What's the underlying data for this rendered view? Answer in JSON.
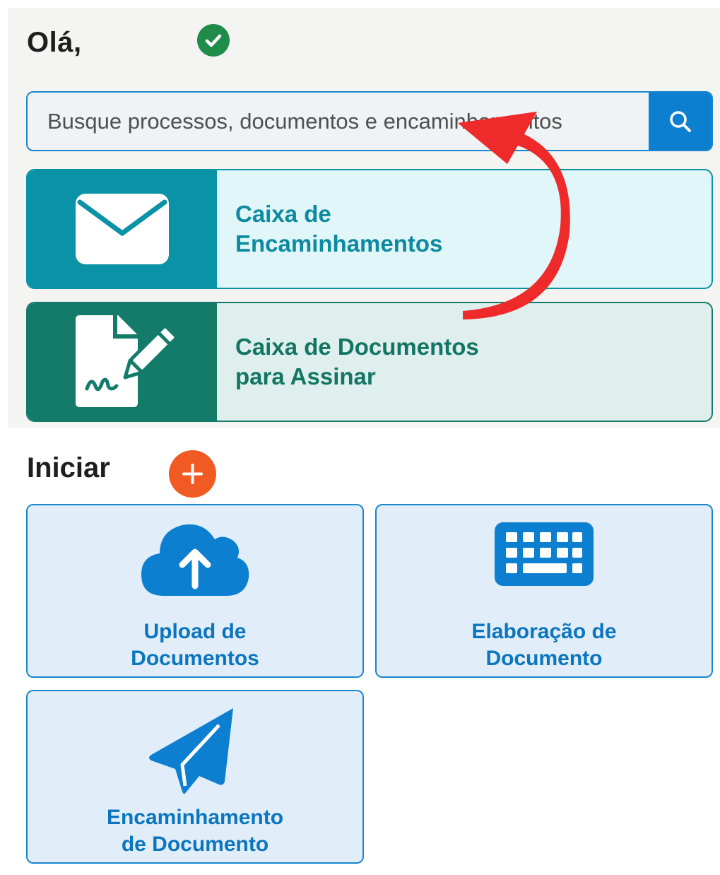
{
  "header": {
    "greeting": "Olá,"
  },
  "search": {
    "placeholder": "Busque processos, documentos e encaminhamentos"
  },
  "cards": [
    {
      "label": "Caixa de\nEncaminhamentos",
      "icon": "envelope-icon"
    },
    {
      "label": "Caixa de Documentos\npara Assinar",
      "icon": "document-signature-icon"
    }
  ],
  "start_section": {
    "title": "Iniciar",
    "tiles": [
      {
        "label": "Upload de\nDocumentos",
        "icon": "cloud-upload-icon"
      },
      {
        "label": "Elaboração de\nDocumento",
        "icon": "keyboard-icon"
      },
      {
        "label": "Encaminhamento\nde Documento",
        "icon": "paper-plane-icon"
      }
    ]
  },
  "colors": {
    "primary_blue": "#1a86cf",
    "inbox_teal": "#0a93a6",
    "sign_green": "#147b6a",
    "verified_green": "#1f8c4a",
    "add_orange": "#f15a22",
    "annotation_red": "#ee2a2a"
  }
}
